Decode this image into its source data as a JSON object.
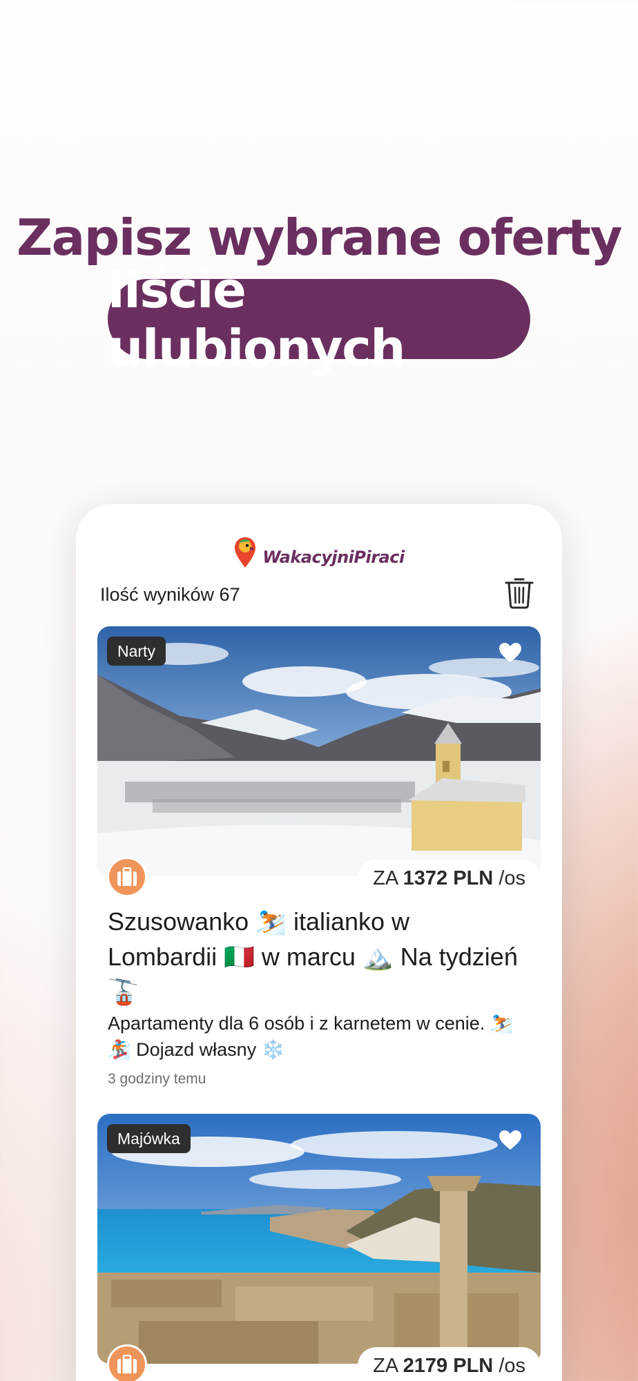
{
  "headline": {
    "line1": "Zapisz wybrane oferty na",
    "line2": "liście ulubionych"
  },
  "app": {
    "logo_text": "WakacyjniPiraci",
    "results_label": "Ilość wyników 67"
  },
  "offers": [
    {
      "badge": "Narty",
      "price_prefix": "ZA",
      "price_value": "1372 PLN",
      "price_suffix": "/os",
      "title": "Szusowanko ⛷️ italianko w Lombardii 🇮🇹 w marcu 🏔️ Na tydzień 🚡",
      "description": "Apartamenty dla 6 osób i z karnetem w cenie. ⛷️ 🏂 Dojazd własny ❄️",
      "time": "3 godziny temu"
    },
    {
      "badge": "Majówka",
      "price_prefix": "ZA",
      "price_value": "2179 PLN",
      "price_suffix": "/os"
    }
  ],
  "colors": {
    "brand": "#6a2f5f",
    "accent_orange": "#f0955a",
    "badge_bg": "#2e2e2e"
  }
}
